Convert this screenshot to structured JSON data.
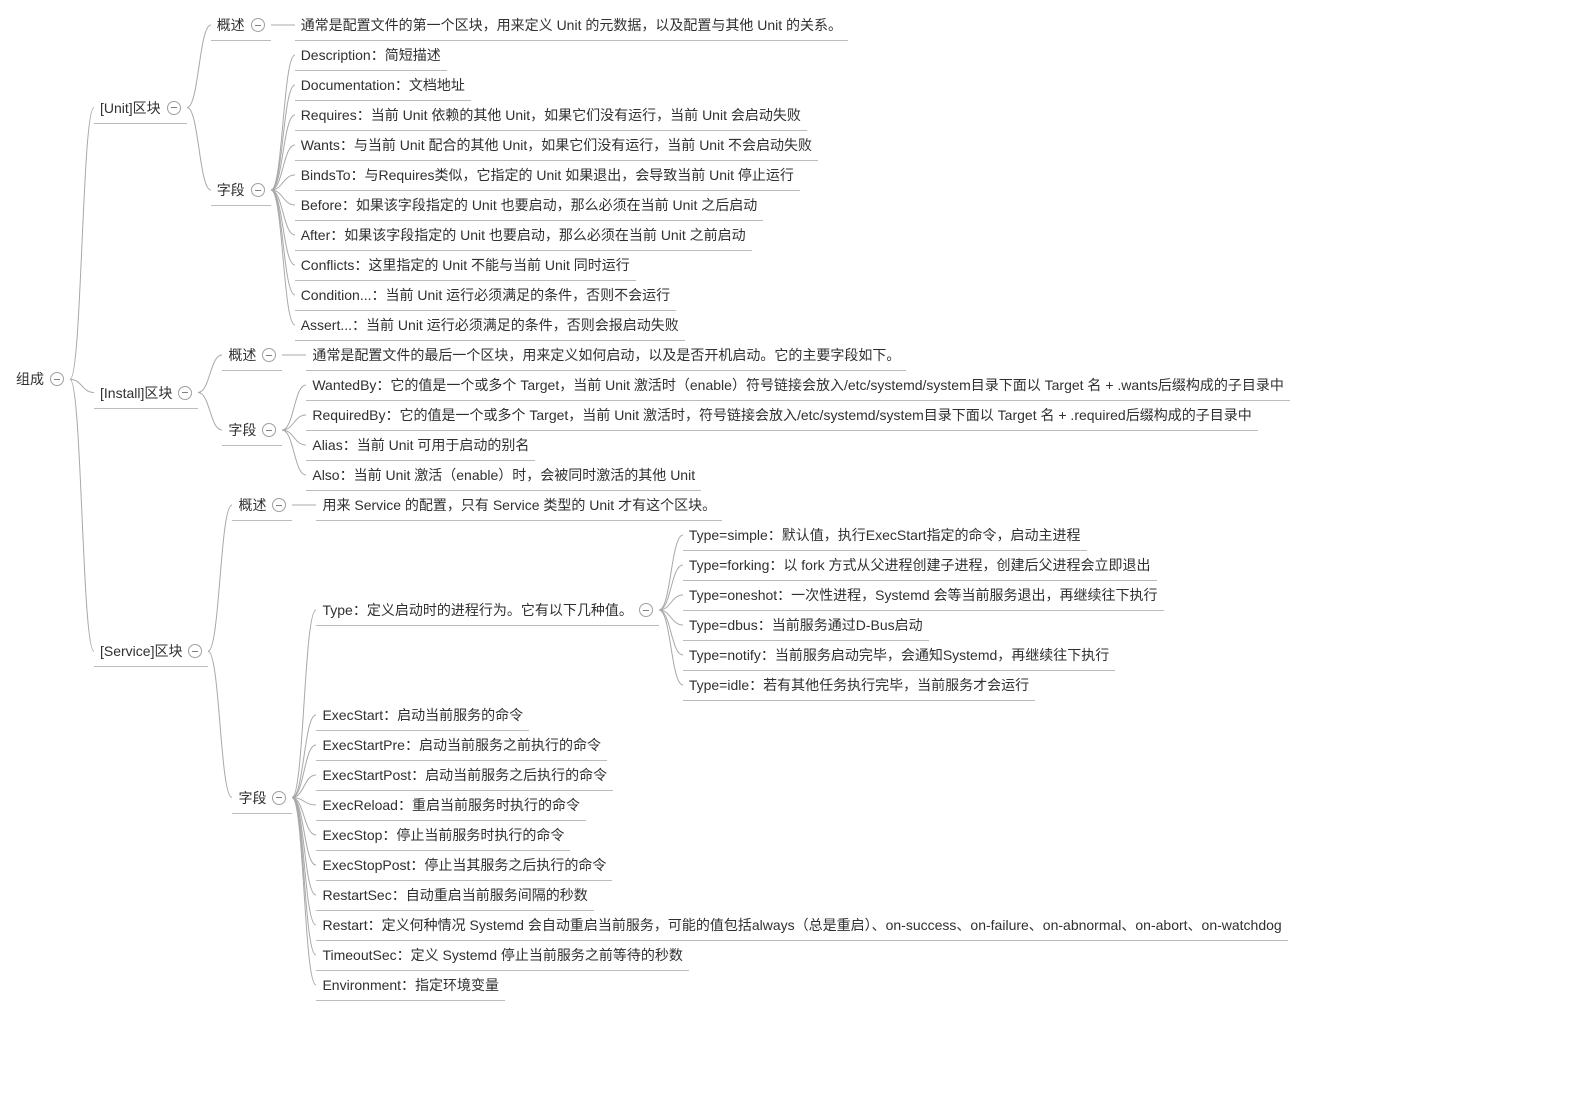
{
  "tree": {
    "text": "组成",
    "toggle": true,
    "children": [
      {
        "text": "[Unit]区块",
        "toggle": true,
        "children": [
          {
            "text": "概述",
            "toggle": true,
            "children": [
              {
                "text": "通常是配置文件的第一个区块，用来定义 Unit 的元数据，以及配置与其他 Unit 的关系。"
              }
            ]
          },
          {
            "text": "字段",
            "toggle": true,
            "children": [
              {
                "text": "Description：简短描述"
              },
              {
                "text": "Documentation：文档地址"
              },
              {
                "text": "Requires：当前 Unit 依赖的其他 Unit，如果它们没有运行，当前 Unit 会启动失败"
              },
              {
                "text": "Wants：与当前 Unit 配合的其他 Unit，如果它们没有运行，当前 Unit 不会启动失败"
              },
              {
                "text": "BindsTo：与Requires类似，它指定的 Unit 如果退出，会导致当前 Unit 停止运行"
              },
              {
                "text": "Before：如果该字段指定的 Unit 也要启动，那么必须在当前 Unit 之后启动"
              },
              {
                "text": "After：如果该字段指定的 Unit 也要启动，那么必须在当前 Unit 之前启动"
              },
              {
                "text": "Conflicts：这里指定的 Unit 不能与当前 Unit 同时运行"
              },
              {
                "text": "Condition...：当前 Unit 运行必须满足的条件，否则不会运行"
              },
              {
                "text": "Assert...：当前 Unit 运行必须满足的条件，否则会报启动失败"
              }
            ]
          }
        ]
      },
      {
        "text": "[Install]区块",
        "toggle": true,
        "children": [
          {
            "text": "概述",
            "toggle": true,
            "children": [
              {
                "text": "通常是配置文件的最后一个区块，用来定义如何启动，以及是否开机启动。它的主要字段如下。"
              }
            ]
          },
          {
            "text": "字段",
            "toggle": true,
            "children": [
              {
                "text": "WantedBy：它的值是一个或多个 Target，当前 Unit 激活时（enable）符号链接会放入/etc/systemd/system目录下面以 Target 名 + .wants后缀构成的子目录中"
              },
              {
                "text": "RequiredBy：它的值是一个或多个 Target，当前 Unit 激活时，符号链接会放入/etc/systemd/system目录下面以 Target 名 + .required后缀构成的子目录中"
              },
              {
                "text": "Alias：当前 Unit 可用于启动的别名"
              },
              {
                "text": "Also：当前 Unit 激活（enable）时，会被同时激活的其他 Unit"
              }
            ]
          }
        ]
      },
      {
        "text": "[Service]区块",
        "toggle": true,
        "children": [
          {
            "text": "概述",
            "toggle": true,
            "children": [
              {
                "text": "用来 Service 的配置，只有 Service 类型的 Unit 才有这个区块。"
              }
            ]
          },
          {
            "text": "字段",
            "toggle": true,
            "children": [
              {
                "text": "Type：定义启动时的进程行为。它有以下几种值。",
                "toggle": true,
                "children": [
                  {
                    "text": "Type=simple：默认值，执行ExecStart指定的命令，启动主进程"
                  },
                  {
                    "text": "Type=forking：以 fork 方式从父进程创建子进程，创建后父进程会立即退出"
                  },
                  {
                    "text": "Type=oneshot：一次性进程，Systemd 会等当前服务退出，再继续往下执行"
                  },
                  {
                    "text": "Type=dbus：当前服务通过D-Bus启动"
                  },
                  {
                    "text": "Type=notify：当前服务启动完毕，会通知Systemd，再继续往下执行"
                  },
                  {
                    "text": "Type=idle：若有其他任务执行完毕，当前服务才会运行"
                  }
                ]
              },
              {
                "text": "ExecStart：启动当前服务的命令"
              },
              {
                "text": "ExecStartPre：启动当前服务之前执行的命令"
              },
              {
                "text": "ExecStartPost：启动当前服务之后执行的命令"
              },
              {
                "text": "ExecReload：重启当前服务时执行的命令"
              },
              {
                "text": "ExecStop：停止当前服务时执行的命令"
              },
              {
                "text": "ExecStopPost：停止当其服务之后执行的命令"
              },
              {
                "text": "RestartSec：自动重启当前服务间隔的秒数"
              },
              {
                "text": "Restart：定义何种情况 Systemd 会自动重启当前服务，可能的值包括always（总是重启）、on-success、on-failure、on-abnormal、on-abort、on-watchdog"
              },
              {
                "text": "TimeoutSec：定义 Systemd 停止当前服务之前等待的秒数"
              },
              {
                "text": "Environment：指定环境变量"
              }
            ]
          }
        ]
      }
    ]
  }
}
